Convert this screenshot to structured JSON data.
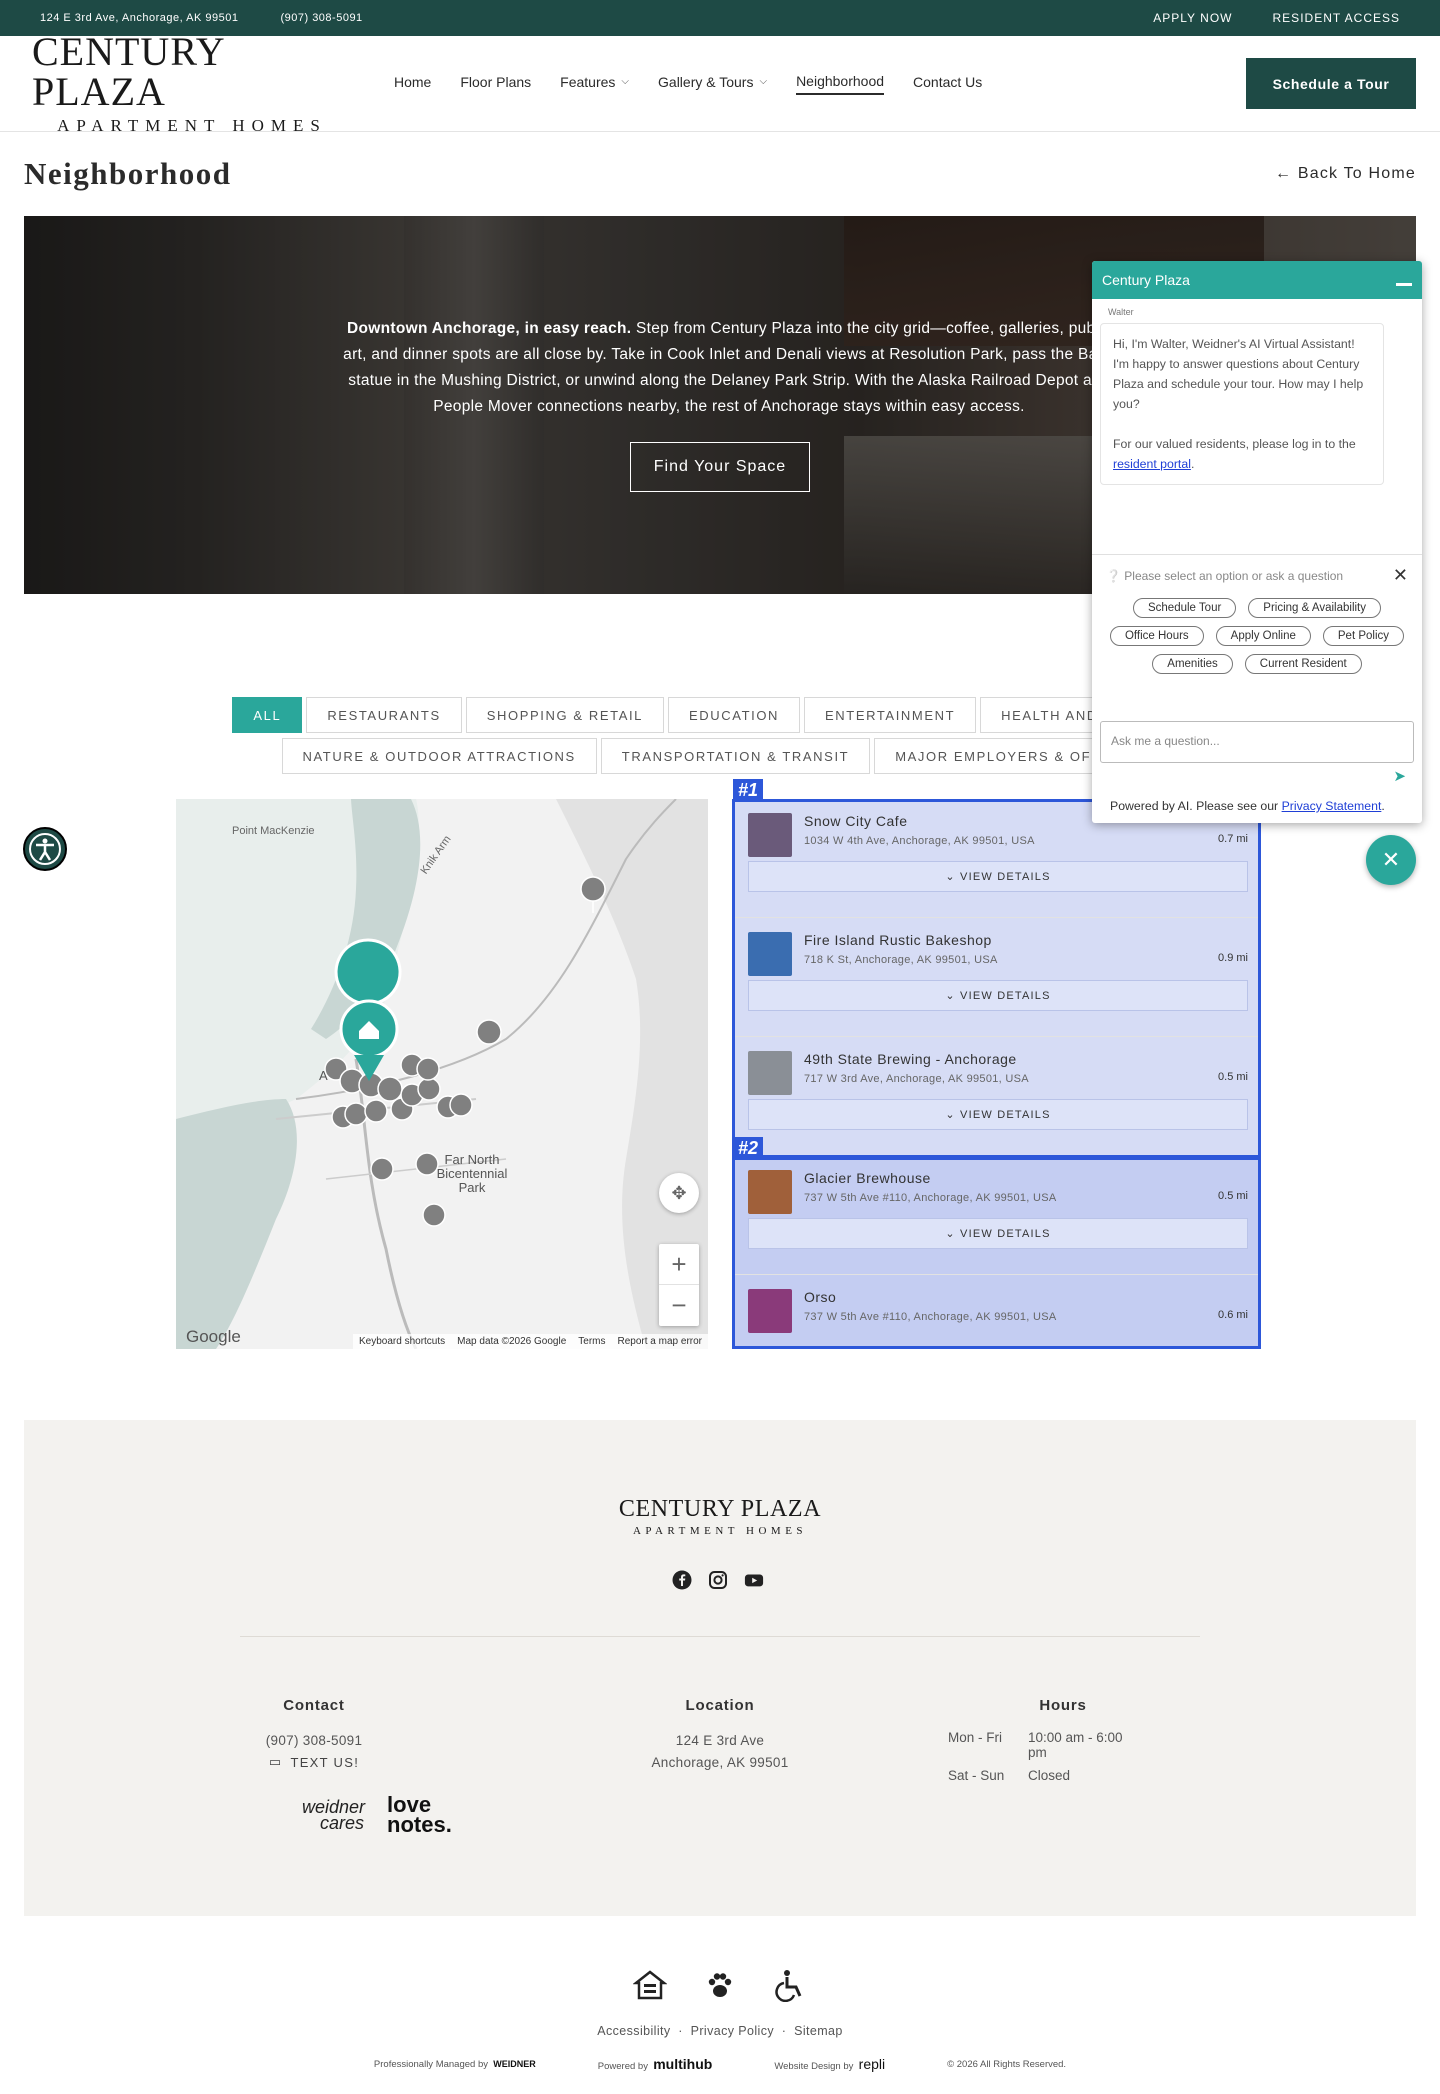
{
  "topbar": {
    "address": "124 E 3rd Ave, Anchorage, AK 99501",
    "phone": "(907) 308-5091",
    "apply": "APPLY NOW",
    "resident": "RESIDENT ACCESS"
  },
  "logo": {
    "line1": "CENTURY PLAZA",
    "line2": "APARTMENT HOMES"
  },
  "nav": {
    "items": [
      "Home",
      "Floor Plans",
      "Features",
      "Gallery & Tours",
      "Neighborhood",
      "Contact Us"
    ],
    "active": "Neighborhood",
    "cta": "Schedule a Tour"
  },
  "page": {
    "title": "Neighborhood",
    "back": "← Back To Home"
  },
  "hero": {
    "lead": "Downtown Anchorage, in easy reach.",
    "body": " Step from Century Plaza into the city grid—coffee, galleries, public art, and dinner spots are all close by. Take in Cook Inlet and Denali views at Resolution Park, pass the Balto statue in the Mushing District, or unwind along the Delaney Park Strip. With the Alaska Railroad Depot and People Mover connections nearby, the rest of Anchorage stays within easy access.",
    "cta": "Find Your Space"
  },
  "filters": {
    "row1": [
      "ALL",
      "RESTAURANTS",
      "SHOPPING & RETAIL",
      "EDUCATION",
      "ENTERTAINMENT",
      "HEALTH AND WELLNESS"
    ],
    "row2": [
      "NATURE & OUTDOOR ATTRACTIONS",
      "TRANSPORTATION & TRANSIT",
      "MAJOR EMPLOYERS & OFFICES"
    ],
    "active": "ALL"
  },
  "map": {
    "labels": [
      "Point MacKenzie",
      "Knik Arm",
      "Far North Bicentennial Park",
      "A"
    ],
    "google": "Google",
    "attribution": [
      "Keyboard shortcuts",
      "Map data ©2026 Google",
      "Terms",
      "Report a map error"
    ],
    "zoom_in": "+",
    "zoom_out": "−"
  },
  "places": [
    {
      "name": "Snow City Cafe",
      "address": "1034 W 4th Ave, Anchorage, AK 99501, USA",
      "distance": "0.7 mi",
      "details": "VIEW DETAILS",
      "thumb": "#6a5a7a"
    },
    {
      "name": "Fire Island Rustic Bakeshop",
      "address": "718 K St, Anchorage, AK 99501, USA",
      "distance": "0.9 mi",
      "details": "VIEW DETAILS",
      "thumb": "#3a6db0"
    },
    {
      "name": "49th State Brewing - Anchorage",
      "address": "717 W 3rd Ave, Anchorage, AK 99501, USA",
      "distance": "0.5 mi",
      "details": "VIEW DETAILS",
      "thumb": "#8a8f96"
    },
    {
      "name": "Glacier Brewhouse",
      "address": "737 W 5th Ave #110, Anchorage, AK 99501, USA",
      "distance": "0.5 mi",
      "details": "VIEW DETAILS",
      "thumb": "#a0603a"
    },
    {
      "name": "Orso",
      "address": "737 W 5th Ave #110, Anchorage, AK 99501, USA",
      "distance": "0.6 mi",
      "details": "VIEW DETAILS",
      "thumb": "#8a3a7a"
    }
  ],
  "highlights": [
    "#1",
    "#2"
  ],
  "chat": {
    "title": "Century Plaza",
    "agent": "Walter",
    "greeting": "Hi, I'm Walter, Weidner's AI Virtual Assistant! I'm happy to answer questions about Century Plaza and schedule your tour. How may I help you?",
    "resident_pre": "For our valued residents, please log in to the ",
    "resident_link": "resident portal",
    "resident_post": ".",
    "prompt": "Please select an option or ask a question",
    "options": [
      "Schedule Tour",
      "Pricing & Availability",
      "Office Hours",
      "Apply Online",
      "Pet Policy",
      "Amenities",
      "Current Resident"
    ],
    "input_placeholder": "Ask me a question...",
    "powered_pre": "Powered by AI. Please see our ",
    "powered_link": "Privacy Statement",
    "powered_post": "."
  },
  "footer": {
    "logo1": "CENTURY PLAZA",
    "logo2": "APARTMENT HOMES",
    "contact_title": "Contact",
    "contact_phone": "(907) 308-5091",
    "text_us": "TEXT US!",
    "location_title": "Location",
    "location_line1": "124 E 3rd Ave",
    "location_line2": "Anchorage, AK 99501",
    "hours_title": "Hours",
    "hours": [
      {
        "days": "Mon - Fri",
        "time": "10:00 am - 6:00 pm"
      },
      {
        "days": "Sat - Sun",
        "time": "Closed"
      }
    ],
    "weidner1": "weidner",
    "weidner2": "cares",
    "love1": "love",
    "love2": "notes."
  },
  "bottom": {
    "links": [
      "Accessibility",
      "Privacy Policy",
      "Sitemap"
    ],
    "managed": "Professionally Managed by",
    "managed_brand": "WEIDNER",
    "powered": "Powered by",
    "powered_brand": "multihub",
    "design": "Website Design by",
    "design_brand": "repli",
    "copyright": "© 2026 All Rights Reserved."
  },
  "colors": {
    "brand": "#1e4a45",
    "accent": "#2aa79b",
    "highlight": "#2d57d9"
  }
}
